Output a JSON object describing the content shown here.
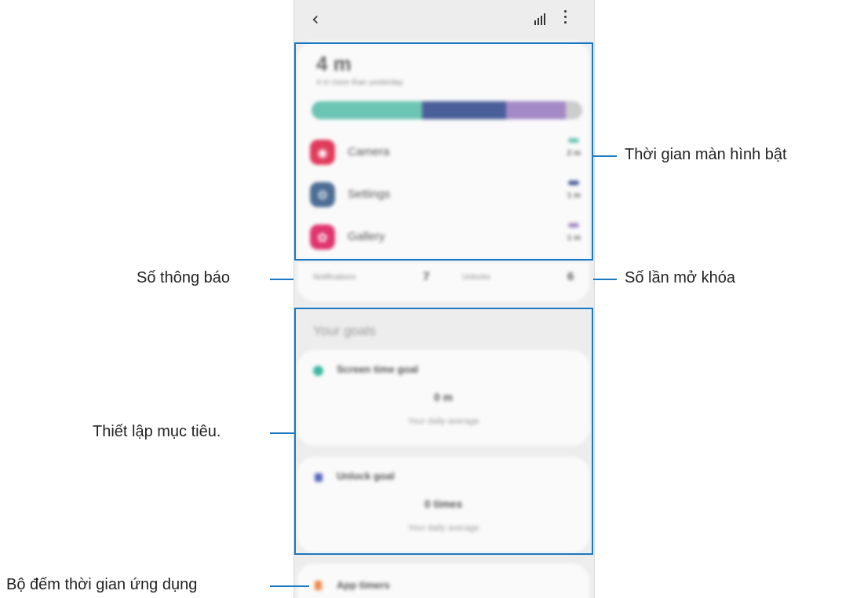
{
  "phone": {
    "top_bar": {
      "back_icon": "‹",
      "signal_icon": "bar-chart-icon",
      "more_icon": "more-vertical-icon"
    },
    "screen_time_card": {
      "total_time": "4 m",
      "comparison": "4 m more than yesterday",
      "usage_bar": [
        {
          "app": "Camera",
          "fraction": 0.41,
          "color": "#6cc4b3"
        },
        {
          "app": "Settings",
          "fraction": 0.31,
          "color": "#4a5f9a"
        },
        {
          "app": "Gallery",
          "fraction": 0.22,
          "color": "#a38ac6"
        },
        {
          "app": "Other",
          "fraction": 0.06,
          "color": "#cccccc"
        }
      ],
      "apps": [
        {
          "name": "Camera",
          "time": "2 m",
          "icon": "camera-icon",
          "color": "#e03b5b",
          "chip": "#6cc4b3"
        },
        {
          "name": "Settings",
          "time": "1 m",
          "icon": "gear-icon",
          "color": "#4d6e94",
          "chip": "#4a5f9a"
        },
        {
          "name": "Gallery",
          "time": "1 m",
          "icon": "flower-icon",
          "color": "#e0356f",
          "chip": "#a38ac6"
        }
      ]
    },
    "stats": {
      "notifications_label": "Notifications",
      "notifications_value": "7",
      "unlocks_label": "Unlocks",
      "unlocks_value": "6"
    },
    "goals": {
      "title": "Your goals",
      "screen_time_goal": {
        "title": "Screen time goal",
        "value": "0 m",
        "subtitle": "Your daily average",
        "icon": "clock-icon",
        "color": "#3bb8a0"
      },
      "unlock_goal": {
        "title": "Unlock goal",
        "value": "0 times",
        "subtitle": "Your daily average",
        "icon": "unlock-icon",
        "color": "#5c6bc0"
      }
    },
    "app_timers": {
      "title": "App timers",
      "icon": "hourglass-icon",
      "color": "#f08a4b"
    }
  },
  "annotations": {
    "screen_on_time": "Thời gian màn hình bật",
    "notifications": "Số thông báo",
    "unlocks": "Số lần mở khóa",
    "goals": "Thiết lập mục tiêu.",
    "app_timers": "Bộ đếm thời gian ứng dụng"
  },
  "colors": {
    "annotation_line": "#1b78c2",
    "screen_background": "#ededed",
    "card_background": "#fafafa"
  }
}
